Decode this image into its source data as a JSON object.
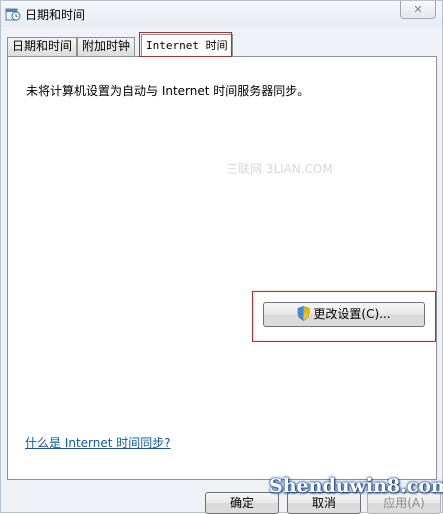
{
  "window": {
    "title": "日期和时间",
    "close_label": "✕",
    "app_icon": "clock-calendar-icon"
  },
  "tabs": [
    {
      "label": "日期和时间",
      "active": false
    },
    {
      "label": "附加时钟",
      "active": false
    },
    {
      "label": "Internet 时间",
      "active": true
    }
  ],
  "panel": {
    "status_text": "未将计算机设置为自动与 Internet 时间服务器同步。",
    "watermark_text": "三联网 3LIAN.COM",
    "change_button_label": "更改设置(C)...",
    "change_button_icon": "uac-shield-icon",
    "help_link_text": "什么是 Internet 时间同步?"
  },
  "footer": {
    "ok_label": "确定",
    "cancel_label": "取消",
    "apply_label": "应用(A)",
    "watermark_text": "Shenduwin8.com"
  },
  "colors": {
    "highlight": "#d01f1f",
    "link": "#0d5aa7"
  }
}
